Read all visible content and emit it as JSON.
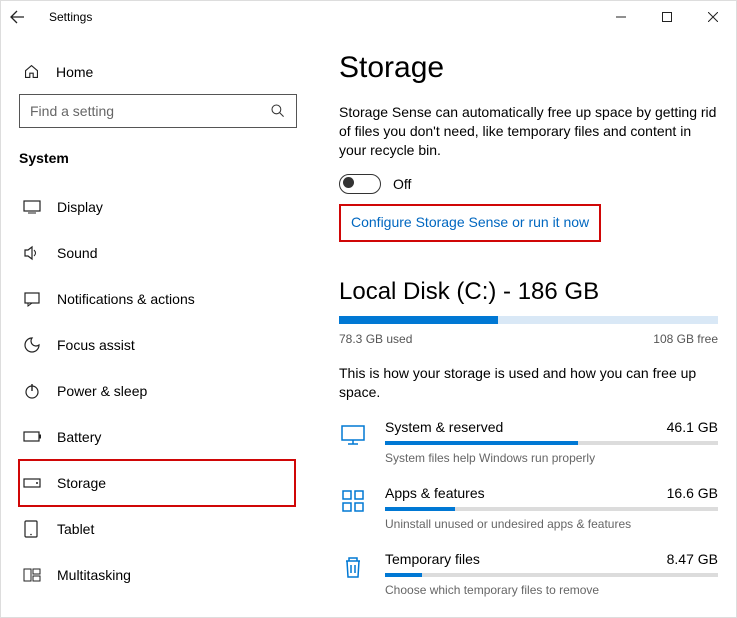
{
  "window": {
    "title": "Settings"
  },
  "sidebar": {
    "home_label": "Home",
    "search_placeholder": "Find a setting",
    "section_label": "System",
    "items": [
      {
        "icon": "display",
        "label": "Display"
      },
      {
        "icon": "sound",
        "label": "Sound"
      },
      {
        "icon": "notify",
        "label": "Notifications & actions"
      },
      {
        "icon": "focus",
        "label": "Focus assist"
      },
      {
        "icon": "power",
        "label": "Power & sleep"
      },
      {
        "icon": "battery",
        "label": "Battery"
      },
      {
        "icon": "storage",
        "label": "Storage"
      },
      {
        "icon": "tablet",
        "label": "Tablet"
      },
      {
        "icon": "multi",
        "label": "Multitasking"
      }
    ]
  },
  "storage": {
    "heading": "Storage",
    "description": "Storage Sense can automatically free up space by getting rid of files you don't need, like temporary files and content in your recycle bin.",
    "toggle_state": "Off",
    "configure_link": "Configure Storage Sense or run it now",
    "disk_title": "Local Disk (C:) - 186 GB",
    "used_label": "78.3 GB used",
    "free_label": "108 GB free",
    "usage_desc": "This is how your storage is used and how you can free up space.",
    "categories": [
      {
        "name": "System & reserved",
        "size": "46.1 GB",
        "sub": "System files help Windows run properly",
        "fill": 58
      },
      {
        "name": "Apps & features",
        "size": "16.6 GB",
        "sub": "Uninstall unused or undesired apps & features",
        "fill": 21
      },
      {
        "name": "Temporary files",
        "size": "8.47 GB",
        "sub": "Choose which temporary files to remove",
        "fill": 11
      }
    ]
  }
}
